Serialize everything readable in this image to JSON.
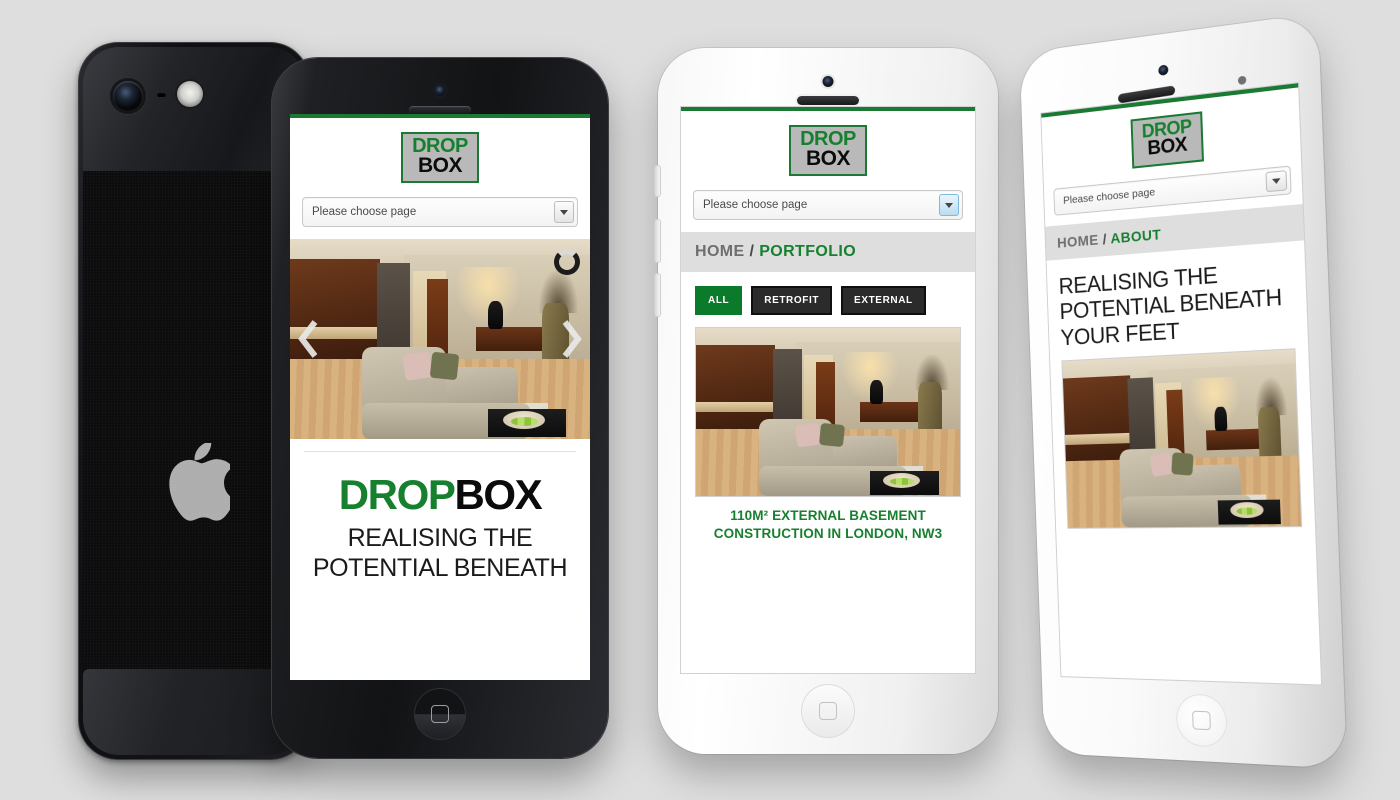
{
  "background_color": "#dedede",
  "brand": {
    "logo_line1": "DROP",
    "logo_line2": "BOX",
    "green": "#17802f",
    "dark": "#0b0b0b",
    "logo_bg": "#b9b9b9"
  },
  "phone_left_back": {
    "device_name": "iPhone black rear",
    "camera": "camera-lens",
    "flash": "camera-flash",
    "mic": "microphone-hole",
    "logo": "apple-logo"
  },
  "phone_left": {
    "device_name": "iPhone black front",
    "page": {
      "topbar_color": "#1a7a34",
      "select": {
        "value": "Please choose page",
        "placeholder": "Please choose page",
        "arrow": "chevron-down-icon"
      },
      "slider": {
        "prev": "prev-arrow-icon",
        "next": "next-arrow-icon",
        "loading": "loading-spinner",
        "image_alt": "Modern basement living room with kitchen and sofa"
      },
      "hero": {
        "title_green": "DROP",
        "title_dark": "BOX",
        "subtitle_line1": "REALISING THE",
        "subtitle_line2": "POTENTIAL BENEATH"
      }
    }
  },
  "phone_middle": {
    "device_name": "iPhone white front",
    "page": {
      "select": {
        "value": "Please choose page",
        "placeholder": "Please choose page",
        "arrow": "chevron-down-icon"
      },
      "breadcrumb": {
        "home": "HOME",
        "separator": "/",
        "current": "PORTFOLIO"
      },
      "filters": [
        {
          "label": "ALL",
          "active": true
        },
        {
          "label": "RETROFIT",
          "active": false
        },
        {
          "label": "EXTERNAL",
          "active": false
        }
      ],
      "portfolio_item": {
        "image_alt": "Modern basement living room with kitchen and sofa",
        "caption": "110M² EXTERNAL BASEMENT CONSTRUCTION IN LONDON, NW3"
      }
    }
  },
  "phone_right": {
    "device_name": "iPhone white front tilted",
    "page": {
      "select": {
        "value": "Please choose page",
        "placeholder": "Please choose page",
        "arrow": "chevron-down-icon"
      },
      "breadcrumb": {
        "home": "HOME",
        "separator": "/",
        "current": "ABOUT"
      },
      "heading_line1": "REALISING THE",
      "heading_line2": "POTENTIAL BENEATH",
      "heading_line3": "YOUR FEET",
      "image_alt": "Modern basement living room with kitchen and sofa"
    }
  }
}
